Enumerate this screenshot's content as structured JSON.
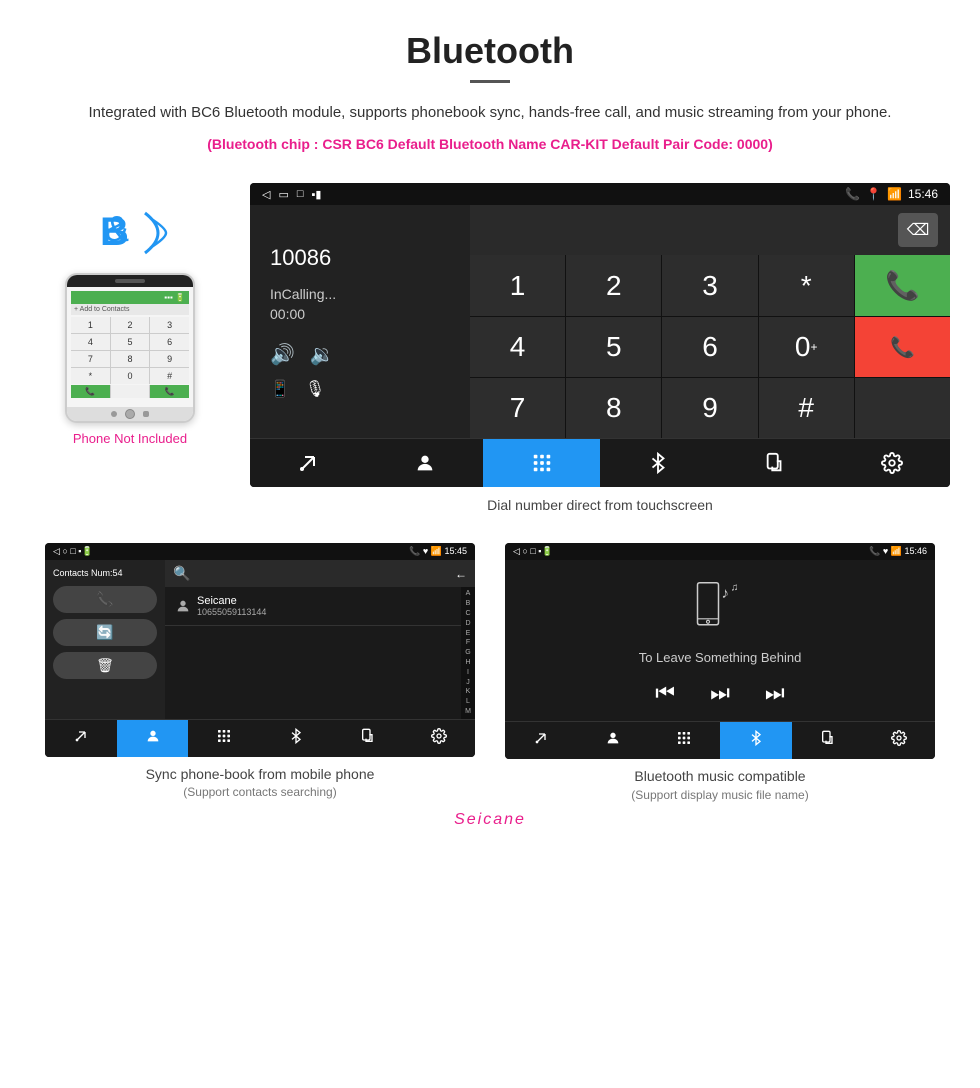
{
  "page": {
    "title": "Bluetooth",
    "divider": true,
    "description": "Integrated with BC6 Bluetooth module, supports phonebook sync, hands-free call, and music streaming from your phone.",
    "specs": "(Bluetooth chip : CSR BC6    Default Bluetooth Name CAR-KIT    Default Pair Code: 0000)"
  },
  "phone_side": {
    "not_included_label": "Phone Not Included"
  },
  "main_screen": {
    "status_bar": {
      "left_icons": [
        "back-icon",
        "window-icon",
        "square-icon",
        "notification-icon"
      ],
      "right_icons": [
        "phone-icon",
        "location-icon",
        "wifi-icon"
      ],
      "time": "15:46"
    },
    "dialer": {
      "number": "10086",
      "status": "InCalling...",
      "timer": "00:00",
      "keys": [
        "1",
        "2",
        "3",
        "*",
        "4",
        "5",
        "6",
        "0+",
        "7",
        "8",
        "9",
        "#"
      ],
      "call_button": "📞",
      "end_button": "📞"
    },
    "nav_bar": {
      "items": [
        "call-transfer",
        "contacts",
        "keypad",
        "bluetooth",
        "phone-settings",
        "settings"
      ]
    },
    "caption": "Dial number direct from touchscreen"
  },
  "bottom_left": {
    "status_bar": {
      "left": "◁  ○  □  📶 🔋",
      "right": "📞 ♥ 📶 15:45"
    },
    "contacts_num": "Contacts Num:54",
    "search_placeholder": "",
    "contact": {
      "name": "Seicane",
      "phone": "10655059113144"
    },
    "alphabet": [
      "A",
      "B",
      "C",
      "D",
      "E",
      "F",
      "G",
      "H",
      "I",
      "J",
      "K",
      "L",
      "M"
    ],
    "action_buttons": [
      "phone",
      "refresh",
      "delete"
    ],
    "nav_items": [
      "call-transfer",
      "contacts",
      "keypad",
      "bluetooth",
      "phone-settings",
      "settings"
    ],
    "caption_main": "Sync phone-book from mobile phone",
    "caption_sub": "(Support contacts searching)"
  },
  "bottom_right": {
    "status_bar": {
      "left": "◁  ○  □  📶 🔋",
      "right": "📞 ♥ 📶 15:46"
    },
    "music_title": "To Leave Something Behind",
    "nav_items": [
      "call-transfer",
      "contacts",
      "keypad",
      "bluetooth",
      "phone-settings",
      "settings"
    ],
    "caption_main": "Bluetooth music compatible",
    "caption_sub": "(Support display music file name)"
  },
  "watermark": "Seicane"
}
